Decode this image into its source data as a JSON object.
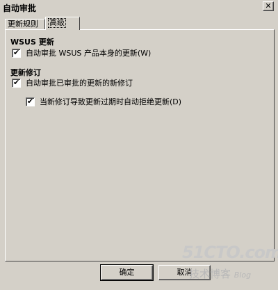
{
  "window": {
    "title": "自动审批"
  },
  "tabs": [
    {
      "label": "更新规则",
      "active": false
    },
    {
      "label": "高级",
      "active": true
    }
  ],
  "sections": {
    "wsus": {
      "title": "WSUS 更新",
      "option1": {
        "label": "自动审批 WSUS 产品本身的更新(W)",
        "checked": true
      }
    },
    "revisions": {
      "title": "更新修订",
      "option1": {
        "label": "自动审批已审批的更新的新修订",
        "checked": true
      },
      "option2": {
        "label": "当新修订导致更新过期时自动拒绝更新(D)",
        "checked": true
      }
    }
  },
  "buttons": {
    "ok": "确定",
    "cancel": "取消"
  },
  "watermark": {
    "logo": "51CTO.com",
    "sub": "技术博客",
    "blog": "Blog"
  },
  "icons": {
    "close": "close-icon",
    "check": "checkmark-icon"
  }
}
